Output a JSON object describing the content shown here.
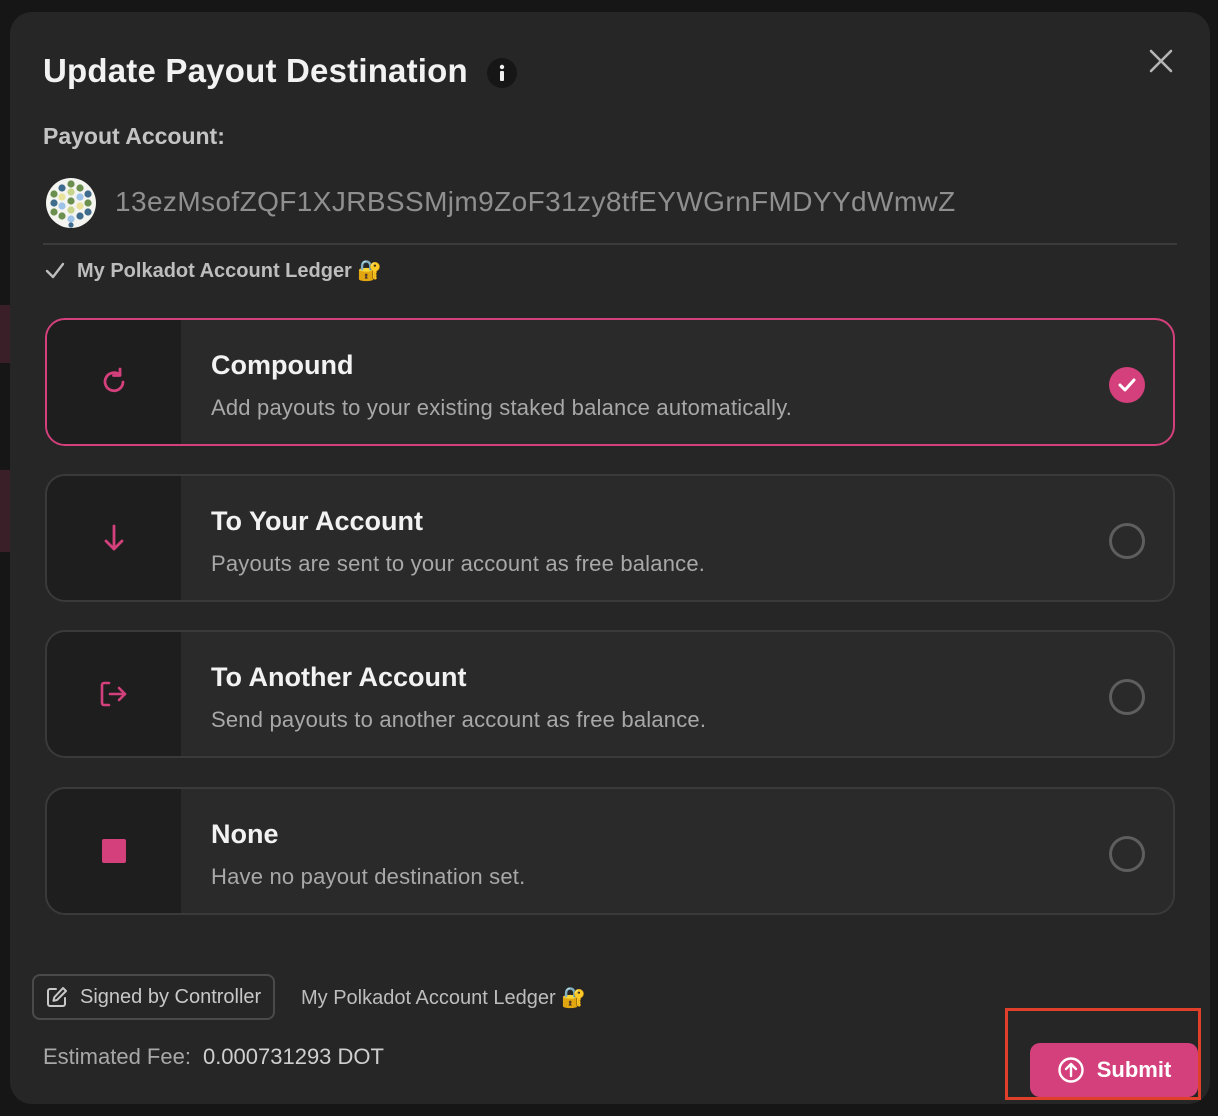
{
  "modal": {
    "title": "Update Payout Destination",
    "payout_label": "Payout Account:",
    "account_address": "13ezMsofZQF1XJRBSSMjm9ZoF31zy8tfEYWGrnFMDYYdWmwZ",
    "ledger_label": "My Polkadot Account Ledger 🔐"
  },
  "options": [
    {
      "title": "Compound",
      "description": "Add payouts to your existing staked balance automatically.",
      "icon": "refresh-icon",
      "selected": true
    },
    {
      "title": "To Your Account",
      "description": "Payouts are sent to your account as free balance.",
      "icon": "arrow-down-icon",
      "selected": false
    },
    {
      "title": "To Another Account",
      "description": "Send payouts to another account as free balance.",
      "icon": "sign-out-icon",
      "selected": false
    },
    {
      "title": "None",
      "description": "Have no payout destination set.",
      "icon": "square-icon",
      "selected": false
    }
  ],
  "footer": {
    "signed_by": "Signed by Controller",
    "signer_account": "My Polkadot Account Ledger 🔐",
    "fee_label": "Estimated Fee:",
    "fee_value": "0.000731293 DOT",
    "submit_label": "Submit"
  },
  "colors": {
    "accent": "#d3407b",
    "modal_bg": "#262626",
    "page_bg": "#161616",
    "highlight_outline": "#e0402a"
  }
}
